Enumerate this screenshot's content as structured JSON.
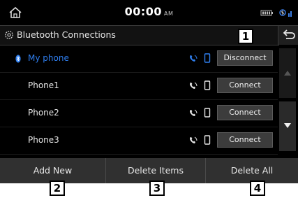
{
  "status": {
    "time": "00:00",
    "ampm": "AM"
  },
  "header": {
    "title": "Bluetooth Connections"
  },
  "devices": [
    {
      "name": "My phone",
      "action": "Disconnect",
      "active": true
    },
    {
      "name": "Phone1",
      "action": "Connect",
      "active": false
    },
    {
      "name": "Phone2",
      "action": "Connect",
      "active": false
    },
    {
      "name": "Phone3",
      "action": "Connect",
      "active": false
    }
  ],
  "bottom_buttons": [
    "Add New",
    "Delete Items",
    "Delete All"
  ],
  "callouts": [
    "1",
    "2",
    "3",
    "4"
  ],
  "colors": {
    "active_text": "#2f7ff0",
    "button_bg": "#3c3c3c",
    "screen_bg": "#000000"
  },
  "icons": [
    "home-icon",
    "bluetooth-settings-icon",
    "back-icon",
    "bluetooth-icon",
    "phone-audio-icon",
    "device-icon",
    "scroll-up-icon",
    "scroll-down-icon",
    "battery-icon",
    "signal-icon"
  ]
}
